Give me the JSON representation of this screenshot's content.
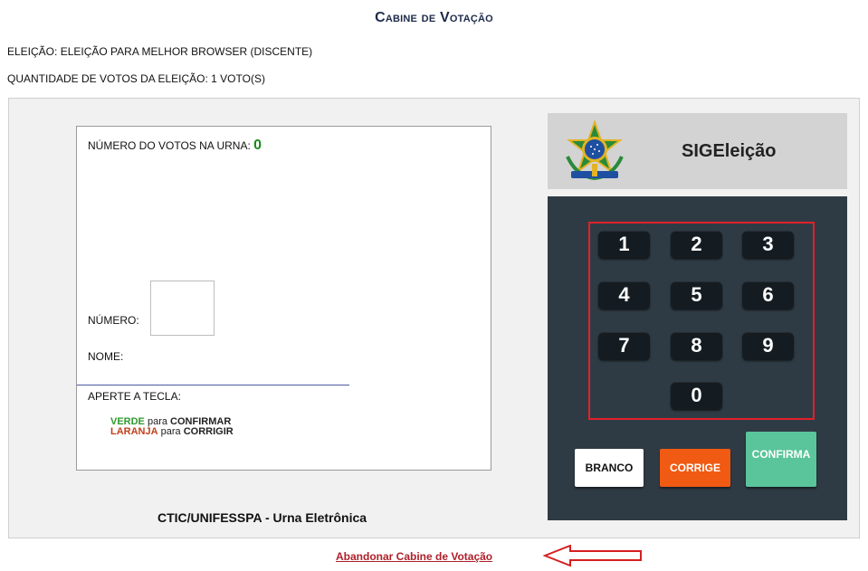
{
  "page": {
    "title": "Cabine de Votação",
    "election_line": "ELEIÇÃO: ELEIÇÃO PARA MELHOR BROWSER (DISCENTE)",
    "votes_quantity_line": "QUANTIDADE DE VOTOS DA ELEIÇÃO: 1 VOTO(S)"
  },
  "screen": {
    "votes_label": "NÚMERO DO VOTOS NA URNA: ",
    "votes_count": "0",
    "numero_label": "NÚMERO:",
    "nome_label": "NOME:",
    "aperte_label": "APERTE A TECLA:",
    "instructions": {
      "verde": "VERDE",
      "para1": " para ",
      "confirmar": "CONFIRMAR",
      "laranja": "LARANJA",
      "para2": " para ",
      "corrigir": "CORRIGIR"
    },
    "footer": "CTIC/UNIFESSPA - Urna Eletrônica"
  },
  "brand": {
    "name": "SIGEleição",
    "emblem_icon": "brazil-coat-of-arms-icon"
  },
  "keypad": {
    "keys": [
      "1",
      "2",
      "3",
      "4",
      "5",
      "6",
      "7",
      "8",
      "9",
      "0"
    ],
    "branco": "BRANCO",
    "corrige": "CORRIGE",
    "confirma": "CONFIRMA"
  },
  "links": {
    "abandon": "Abandonar Cabine de Votação"
  },
  "colors": {
    "keypad_bg": "#2f3b44",
    "keys_frame": "#e2202a",
    "corrige": "#f15a12",
    "confirma": "#5ac59a",
    "votes_count": "#1a8a1a"
  }
}
